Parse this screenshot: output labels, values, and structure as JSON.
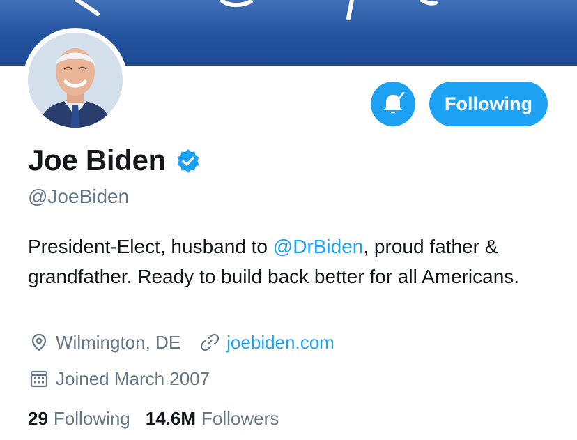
{
  "profile": {
    "name": "Joe Biden",
    "handle": "@JoeBiden",
    "verified": true,
    "bio_prefix": "President-Elect, husband to ",
    "bio_mention": "@DrBiden",
    "bio_suffix": ", proud father & grandfather. Ready to build back better for all Americans.",
    "location": "Wilmington, DE",
    "website": "joebiden.com",
    "joined": "Joined March 2007"
  },
  "actions": {
    "notify_icon": "bell-check-icon",
    "follow_label": "Following"
  },
  "stats": {
    "following_count": "29",
    "following_label": "Following",
    "followers_count": "14.6M",
    "followers_label": "Followers"
  },
  "colors": {
    "accent": "#1da1f2",
    "secondary_text": "#657786",
    "banner": "#24539f"
  }
}
